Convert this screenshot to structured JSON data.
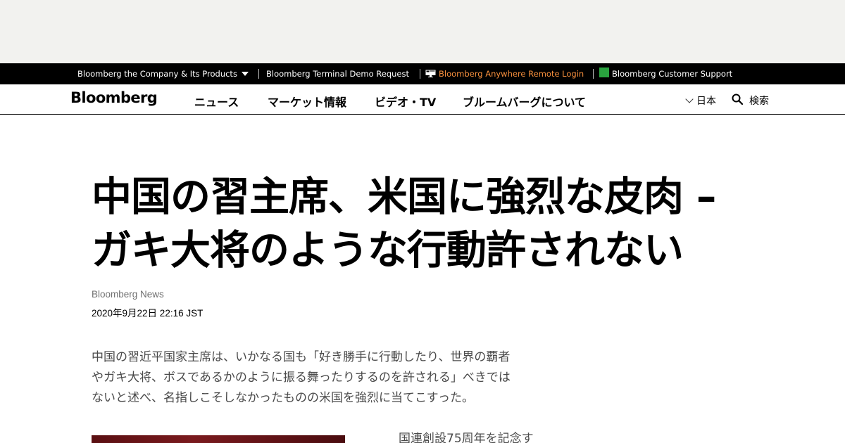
{
  "corporate_bar": {
    "company_link": "Bloomberg the Company & Its Products",
    "terminal_demo": "Bloomberg Terminal Demo Request",
    "anywhere_login": "Bloomberg Anywhere Remote Login",
    "customer_support": "Bloomberg Customer Support",
    "accent_color": "#f68f3d"
  },
  "nav": {
    "logo": "Bloomberg",
    "links": [
      "ニュース",
      "マーケット情報",
      "ビデオ・TV",
      "ブルームバーグについて"
    ],
    "language": "日本",
    "search_label": "検索"
  },
  "article": {
    "headline_line1": "中国の習主席、米国に強烈な皮肉 –",
    "headline_line2": "ガキ大将のような行動許されない",
    "byline": "Bloomberg News",
    "timestamp": "2020年9月22日 22:16 JST",
    "lede_line1": "中国の習近平国家主席は、いかなる国も「好き勝手に行動したり、世界の覇者",
    "lede_line2": "やガキ大将、ボスであるかのように振る舞ったりするのを許される」べきでは",
    "lede_line3": "ないと述べ、名指しこそしなかったものの米国を強烈に当てこすった。",
    "body_start": "国連創設75周年を記念す"
  }
}
